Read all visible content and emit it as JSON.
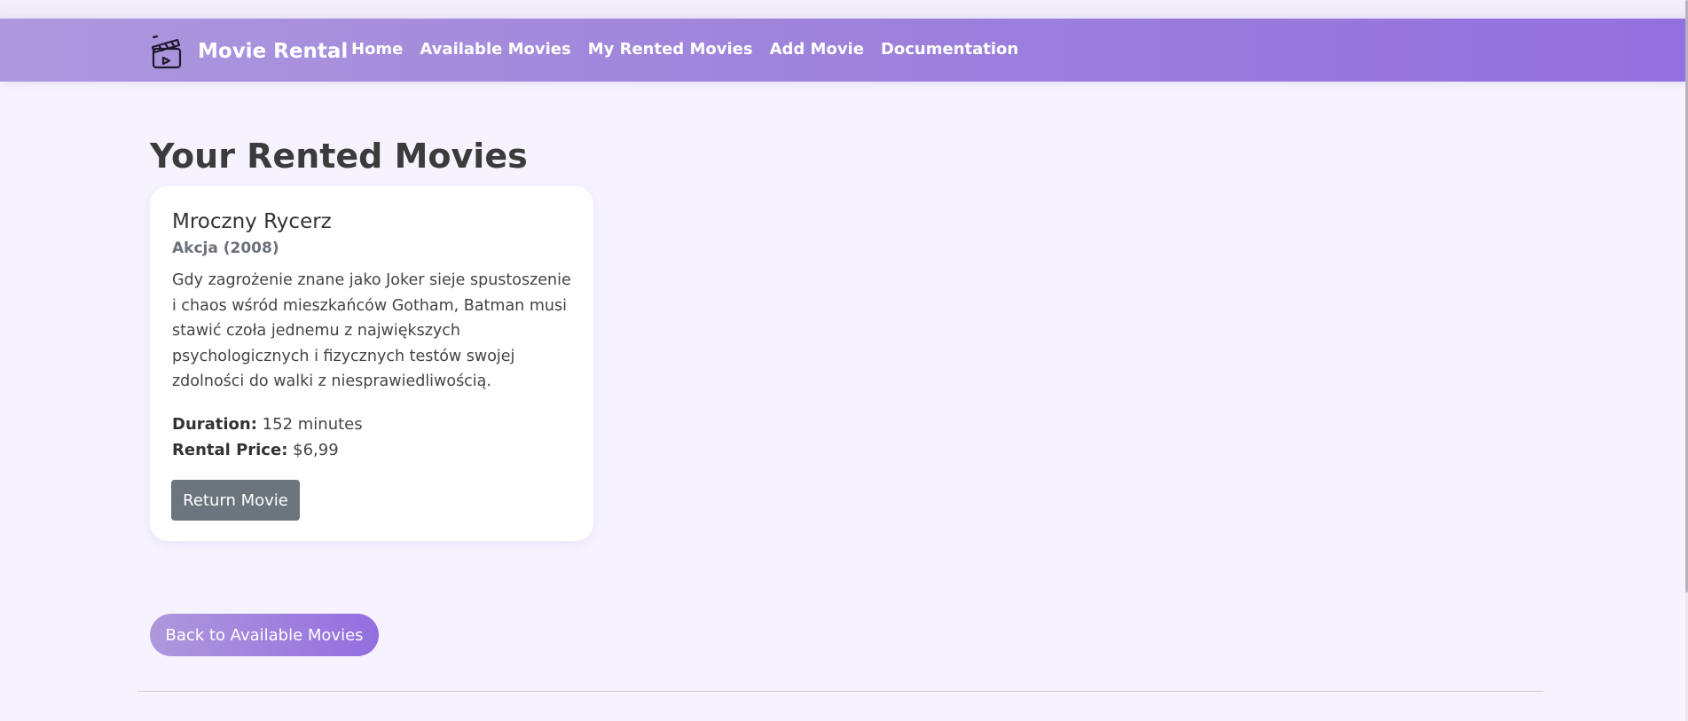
{
  "navbar": {
    "brand": "Movie Rental",
    "brand_icon": "clapperboard-icon",
    "links": [
      "Home",
      "Available Movies",
      "My Rented Movies",
      "Add Movie",
      "Documentation"
    ]
  },
  "main": {
    "title": "Your Rented Movies",
    "movies": [
      {
        "title": "Mroczny Rycerz",
        "genre_year": "Akcja (2008)",
        "description": "Gdy zagrożenie znane jako Joker sieje spustoszenie i chaos wśród mieszkańców Gotham, Batman musi stawić czoła jednemu z największych psychologicznych i fizycznych testów swojej zdolności do walki z niesprawiedliwością.",
        "duration_label": "Duration:",
        "duration_value": "152 minutes",
        "price_label": "Rental Price:",
        "price_value": "$6,99",
        "return_button": "Return Movie"
      }
    ],
    "back_button": "Back to Available Movies"
  },
  "colors": {
    "background": "#f7f3fe",
    "navbar_start": "#ad98dd",
    "navbar_end": "#9470de",
    "return_button": "#6c757d",
    "accent": "#946ee0"
  }
}
